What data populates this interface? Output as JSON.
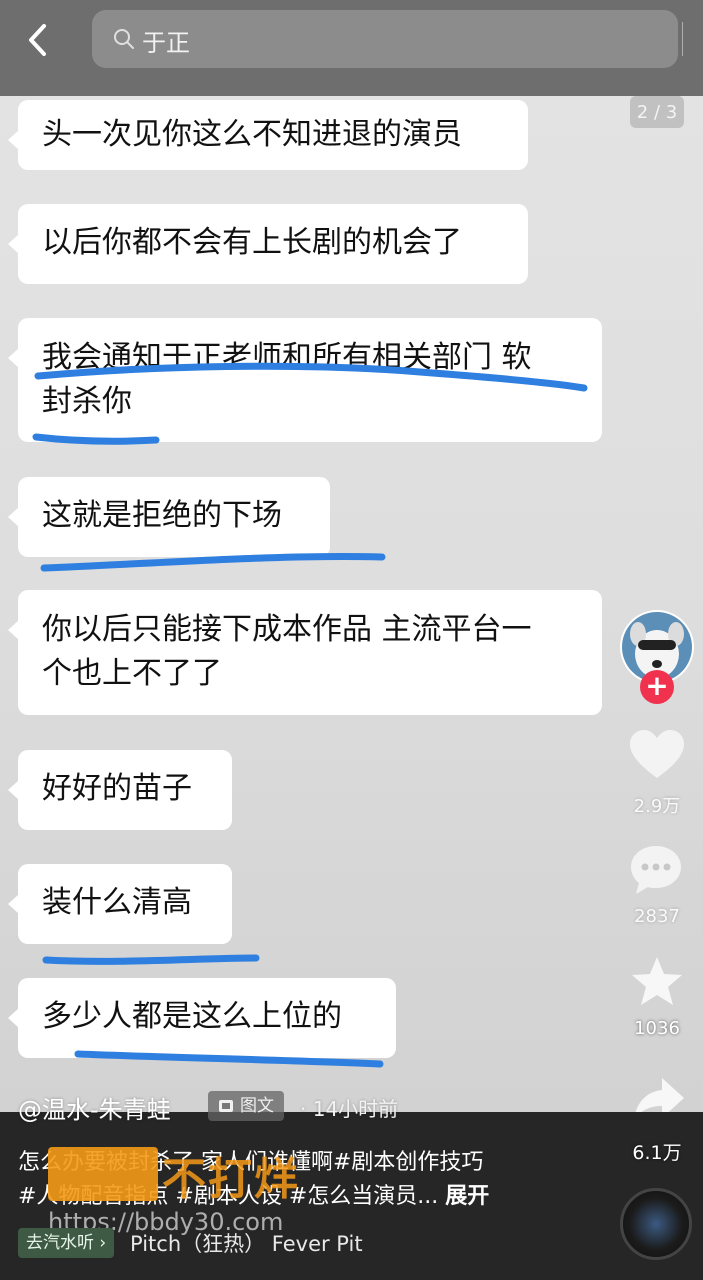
{
  "search": {
    "query": "于正",
    "button": "搜索"
  },
  "page_indicator": "2 / 3",
  "messages": [
    "头一次见你这么不知进退的演员",
    "以后你都不会有上长剧的机会了",
    "我会通知于正老师和所有相关部门 软",
    "封杀你",
    "这就是拒绝的下场",
    "你以后只能接下成本作品 主流平台一",
    "个也上不了了",
    "好好的苗子",
    "装什么清高",
    "多少人都是这么上位的"
  ],
  "side": {
    "likes": "2.9万",
    "comments": "2837",
    "favorites": "1036",
    "shares": "6.1万"
  },
  "post": {
    "author": "@温水-朱青蛙",
    "type_tag": "图文",
    "time": "· 14小时前",
    "desc_line1": "怎么办要被封杀了 家人们谁懂啊#剧本创作技巧",
    "desc_line2": "#人物配音指点 #剧本人设 #怎么当演员...",
    "expand": "展开",
    "music_tag": "去汽水听 ›",
    "music": "Pitch（狂热）   Fever Pit"
  },
  "watermark": {
    "text": "不打烊",
    "url": "https://bbdy30.com"
  },
  "colors": {
    "underline": "#2f7fe0",
    "follow": "#f0324f",
    "music_tag": "#3e5a44",
    "watermark": "#f49a17"
  }
}
